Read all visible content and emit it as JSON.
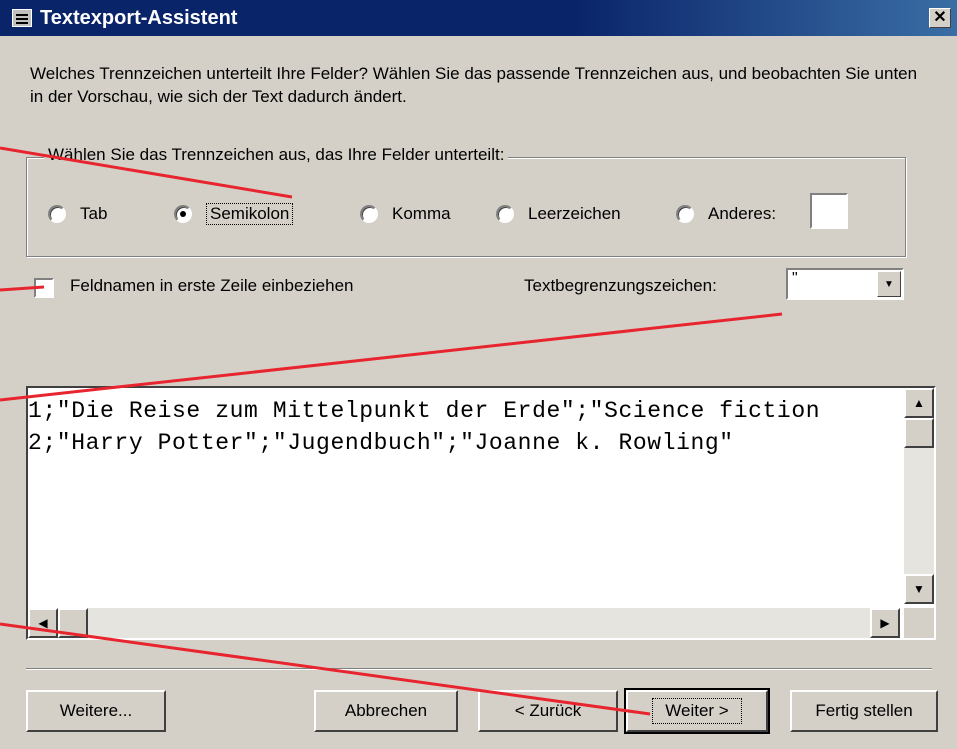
{
  "window": {
    "title": "Textexport-Assistent",
    "icon": "table-icon",
    "close_label": "✕"
  },
  "intro_text": "Welches Trennzeichen unterteilt Ihre Felder?  Wählen Sie das passende Trennzeichen aus, und beobachten Sie unten in der Vorschau, wie sich der Text dadurch ändert.",
  "delimiter_group": {
    "legend": "Wählen Sie das Trennzeichen aus, das Ihre Felder unterteilt:",
    "options": [
      {
        "label": "Tab",
        "checked": false
      },
      {
        "label": "Semikolon",
        "checked": true
      },
      {
        "label": "Komma",
        "checked": false
      },
      {
        "label": "Leerzeichen",
        "checked": false
      },
      {
        "label": "Anderes:",
        "checked": false
      }
    ],
    "other_value": ""
  },
  "field_names_checkbox": {
    "label": "Feldnamen in erste Zeile einbeziehen",
    "checked": false
  },
  "text_qualifier": {
    "label": "Textbegrenzungszeichen:",
    "value": "\""
  },
  "preview": {
    "lines": [
      "1;\"Die Reise zum Mittelpunkt der Erde\";\"Science fiction",
      "2;\"Harry Potter\";\"Jugendbuch\";\"Joanne k. Rowling\""
    ]
  },
  "buttons": {
    "advanced": "Weitere...",
    "cancel": "Abbrechen",
    "back": "< Zurück",
    "next": "Weiter >",
    "finish": "Fertig stellen"
  },
  "colors": {
    "titlebar": "#0a246a",
    "dialog_bg": "#d4d0c8",
    "annotation_line": "#e8252f"
  }
}
